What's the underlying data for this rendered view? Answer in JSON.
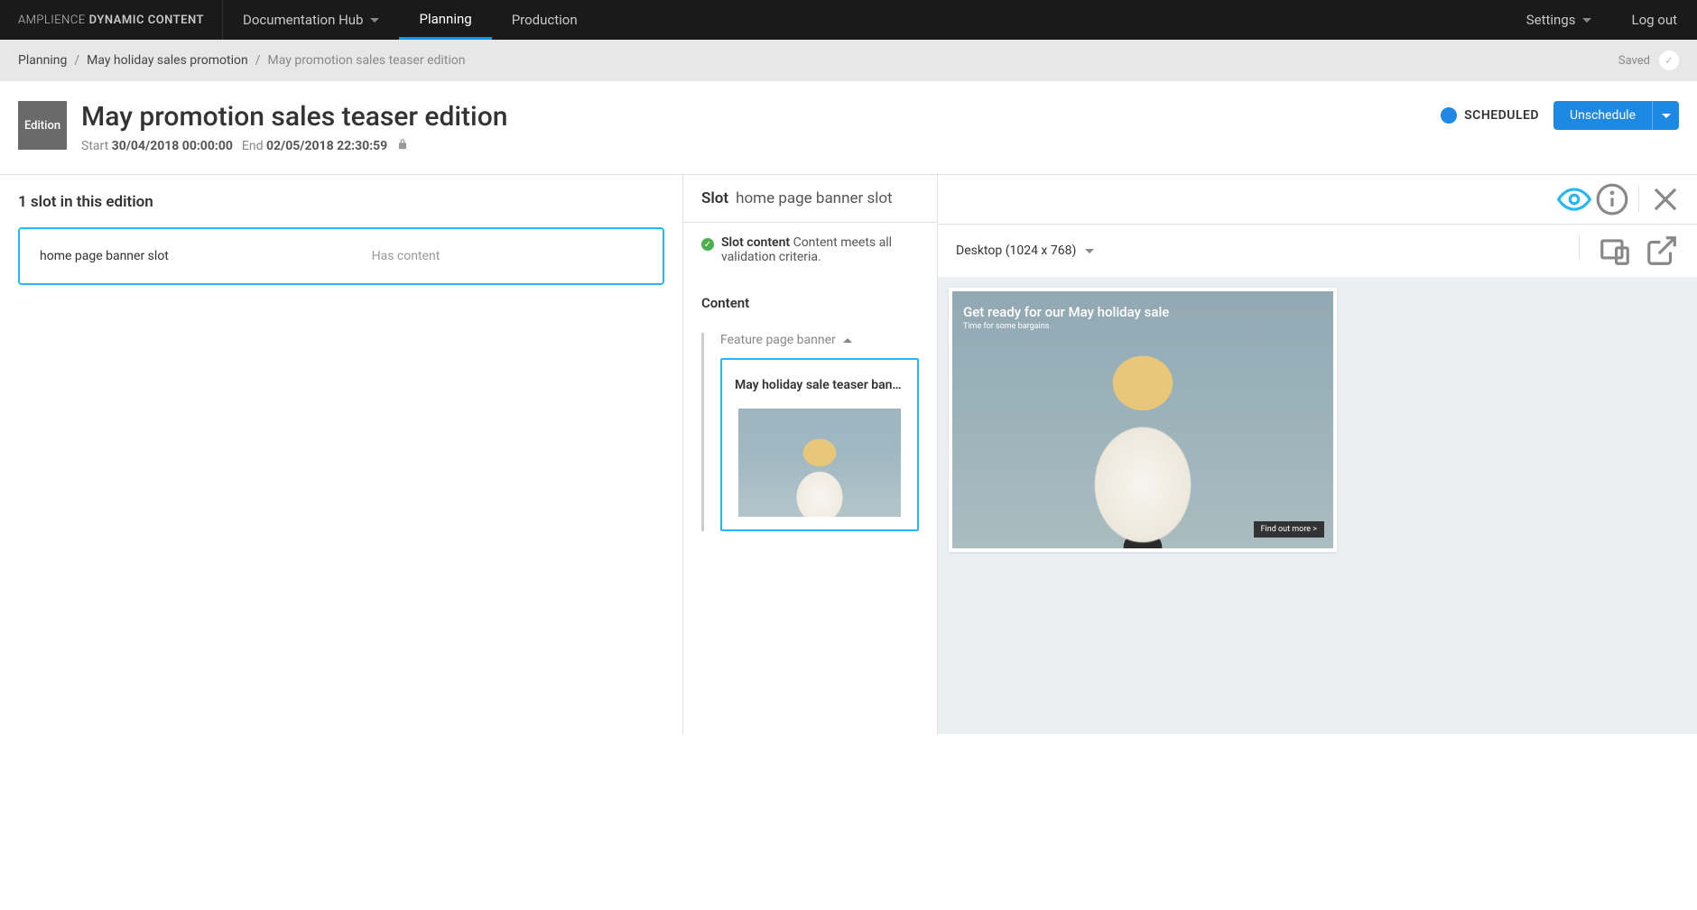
{
  "brand": {
    "name1": "AMPLIENCE",
    "name2": "DYNAMIC CONTENT"
  },
  "nav": {
    "docHub": "Documentation Hub",
    "planning": "Planning",
    "production": "Production",
    "settings": "Settings",
    "logout": "Log out"
  },
  "breadcrumb": {
    "root": "Planning",
    "parent": "May holiday sales promotion",
    "current": "May promotion sales teaser edition",
    "saved": "Saved"
  },
  "edition": {
    "badge": "Edition",
    "title": "May promotion sales teaser edition",
    "start_label": "Start",
    "start_value": "30/04/2018 00:00:00",
    "end_label": "End",
    "end_value": "02/05/2018 22:30:59",
    "status": "SCHEDULED",
    "unschedule": "Unschedule"
  },
  "slots": {
    "heading": "1 slot in this edition",
    "card_name": "home page banner slot",
    "card_status": "Has content"
  },
  "slot": {
    "label": "Slot",
    "name": "home page banner slot",
    "content_label": "Slot content",
    "content_desc": "Content meets all validation criteria.",
    "content_heading": "Content",
    "feature_label": "Feature page banner",
    "card_title": "May holiday sale teaser ban…"
  },
  "preview": {
    "device": "Desktop (1024 x 768)",
    "banner_title": "Get ready for our May holiday sale",
    "banner_sub": "Time for some bargains",
    "cta": "Find out more >"
  }
}
